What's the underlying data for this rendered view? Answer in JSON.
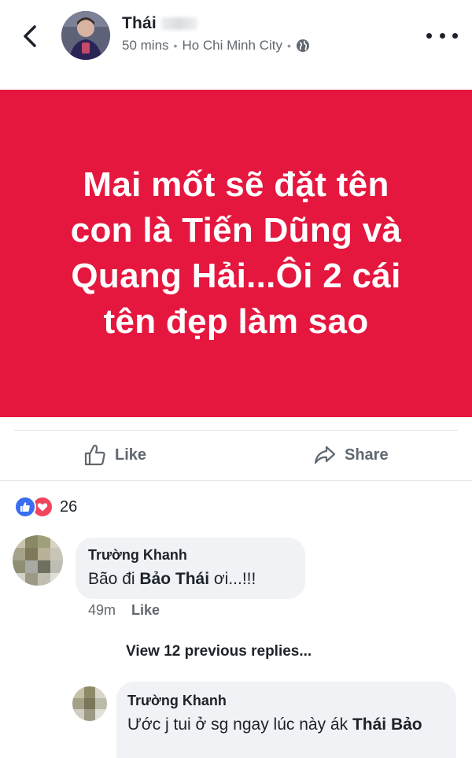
{
  "post": {
    "author": "Thái",
    "time": "50 mins",
    "location": "Ho Chi Minh City",
    "privacy_icon": "globe-icon",
    "text": "Mai mốt sẽ đặt tên con là Tiến Dũng và Quang Hải...Ôi 2 cái tên đẹp làm sao",
    "background_color": "#e5173f"
  },
  "actions": {
    "like_label": "Like",
    "share_label": "Share"
  },
  "reactions": {
    "types": [
      "like",
      "love"
    ],
    "count": "26"
  },
  "comments": [
    {
      "author": "Trường Khanh",
      "text_before": "Bão đi ",
      "text_bold": "Bảo Thái",
      "text_after": " ơi...!!!",
      "time": "49m",
      "like_label": "Like"
    },
    {
      "author": "Trường Khanh",
      "text_before": "Ước j tui ở sg ngay lúc này ák ",
      "text_bold": "Thái Bảo",
      "text_after": ""
    }
  ],
  "view_replies_label": "View 12 previous replies..."
}
